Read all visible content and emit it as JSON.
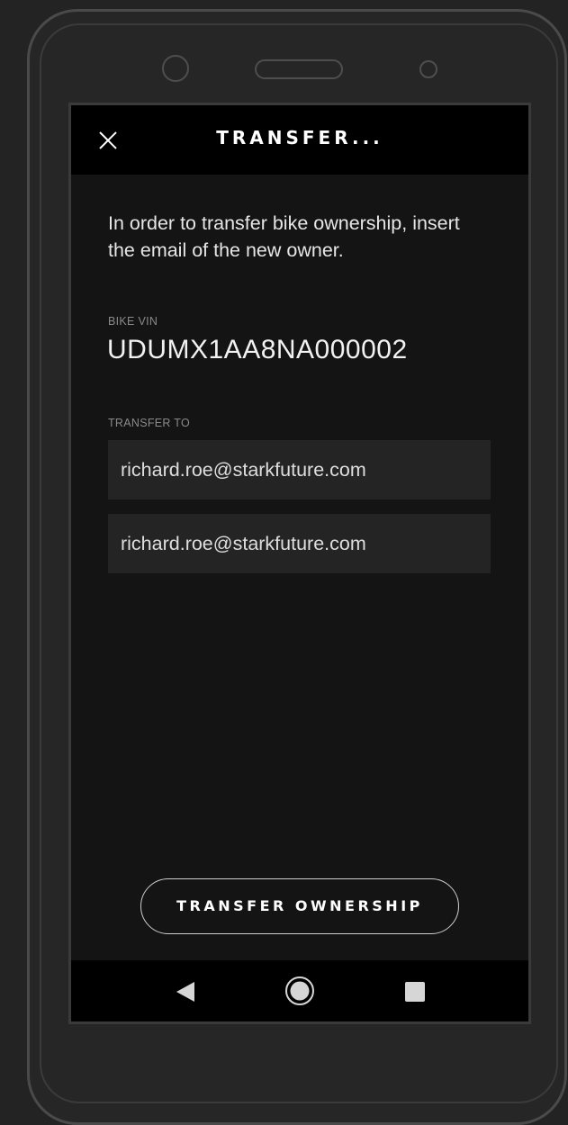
{
  "header": {
    "title": "TRANSFER...",
    "close_icon": "close-icon"
  },
  "intro": {
    "text": "In order to transfer bike ownership, insert the email of the new owner."
  },
  "bike_vin": {
    "label": "BIKE VIN",
    "value": "UDUMX1AA8NA000002"
  },
  "transfer_to": {
    "label": "TRANSFER TO",
    "email_value": "richard.roe@starkfuture.com",
    "confirm_email_value": "richard.roe@starkfuture.com"
  },
  "actions": {
    "transfer_label": "TRANSFER OWNERSHIP"
  },
  "nav_bar": {
    "back_icon": "back-triangle-icon",
    "home_icon": "home-circle-icon",
    "recents_icon": "recents-square-icon"
  },
  "colors": {
    "screen_background": "#141414",
    "header_background": "#000000",
    "field_background": "#242424",
    "text_primary": "#ffffff",
    "text_label": "#8a8a8a"
  }
}
